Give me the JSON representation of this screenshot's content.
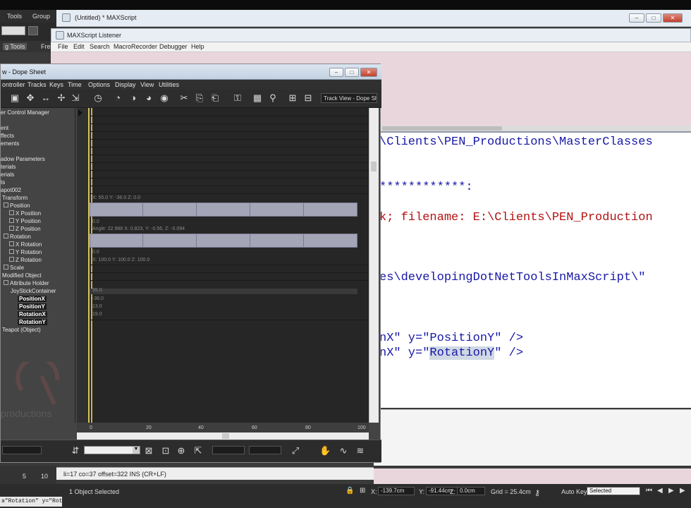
{
  "main_menu": {
    "tools": "Tools",
    "group": "Group"
  },
  "ribbon": {
    "tab": "g Tools",
    "tab2": "Free"
  },
  "maxscript": {
    "title": "(Untitled) * MAXScript"
  },
  "listener": {
    "title": "MAXScript Listener",
    "menu": [
      "File",
      "Edit",
      "Search",
      "MacroRecorder",
      "Debugger",
      "Help"
    ]
  },
  "code_lines": [
    "\\Clients\\PEN_Productions\\MasterClasses",
    "************:",
    "k; filename: E:\\Clients\\PEN_Production",
    "es\\developingDotNetToolsInMaxScript\\\"",
    "nX\" y=\"PositionY\" />",
    "nX\" y=\"",
    "RotationY",
    "\" />"
  ],
  "trackview": {
    "title": "w - Dope Sheet",
    "menu": [
      "ontroller",
      "Tracks",
      "Keys",
      "Time",
      "Options",
      "Display",
      "View",
      "Utilities"
    ],
    "toolbar_label": "Track View - Dope She",
    "tree": [
      "er Control Manager",
      "ent",
      "ffects",
      "ements",
      "adow Parameters",
      "terials",
      "erials",
      "ts",
      "apot002",
      "Transform",
      "Position",
      "X Position",
      "Y Position",
      "Z Position",
      "Rotation",
      "X Rotation",
      "Y Rotation",
      "Z Rotation",
      "Scale",
      "Modified Object",
      "Attribute Holder",
      "JoyStickContainer",
      "PositionX",
      "PositionY",
      "RotationX",
      "RotationY",
      "Teapot (Object)"
    ],
    "grid_text": {
      "pos": "X: 55.0 Y: -36.0 Z: 0.0",
      "pos_val": "0.0",
      "rot": "Angle: 22.988  X: 0.823, Y: -0.56, Z: -0.094",
      "rot_val": "0.0",
      "scale": "X: 100.0 Y: 100.0 Z: 100.0",
      "scale_val": "0.0",
      "v1": "55.0",
      "v2": "-36.0",
      "v3": "13.0",
      "v4": "19.0"
    },
    "ruler": [
      "0",
      "20",
      "40",
      "60",
      "80",
      "100"
    ]
  },
  "status_line": "li=17 co=37 offset=322 INS (CR+LF)",
  "statusbar": {
    "left_numbers": [
      "5",
      "10"
    ],
    "selected": "1 Object Selected",
    "x_label": "X:",
    "x_val": "-139.7cm",
    "y_label": "Y:",
    "y_val": "-91.44cm",
    "z_label": "Z:",
    "z_val": "0.0cm",
    "grid": "Grid = 25.4cm",
    "auto_key": "Auto Key",
    "key_set": "Selected",
    "script_peek": "a\"Rotation\" y=\"Rot"
  },
  "colors": {
    "keybar": "#a5a5b8",
    "time_slider": "#d8c55c",
    "code_blue": "#1818a8",
    "code_red": "#b31212"
  }
}
